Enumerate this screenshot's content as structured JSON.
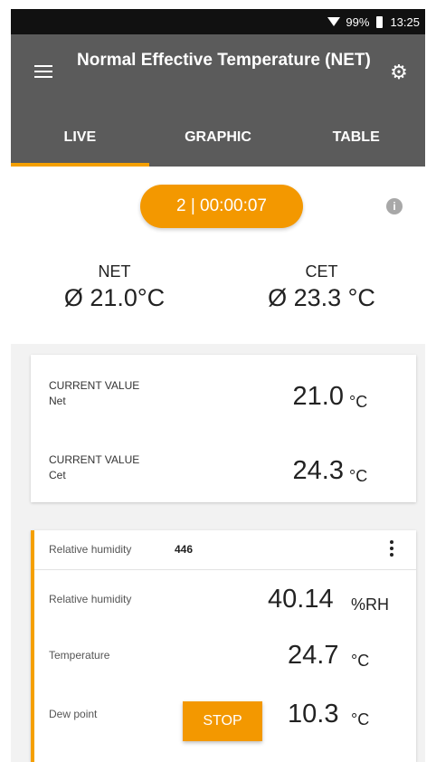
{
  "status_bar": {
    "battery": "99%",
    "time": "13:25"
  },
  "app_bar": {
    "title": "Normal Effective Temperature (NET)"
  },
  "tabs": [
    {
      "label": "LIVE",
      "active": true
    },
    {
      "label": "GRAPHIC",
      "active": false
    },
    {
      "label": "TABLE",
      "active": false
    }
  ],
  "live": {
    "timer": "2 | 00:00:07",
    "summary": [
      {
        "label": "NET",
        "value": "Ø 21.0°C"
      },
      {
        "label": "CET",
        "value": "Ø 23.3 °C"
      }
    ]
  },
  "current_values": [
    {
      "title": "CURRENT VALUE",
      "subtitle": "Net",
      "value": "21.0",
      "unit": "°C"
    },
    {
      "title": "CURRENT VALUE",
      "subtitle": "Cet",
      "value": "24.3",
      "unit": "°C"
    }
  ],
  "probe": {
    "name": "Relative humidity",
    "id": "446",
    "measurements": [
      {
        "label": "Relative humidity",
        "value": "40.14",
        "unit": "%RH"
      },
      {
        "label": "Temperature",
        "value": "24.7",
        "unit": "°C"
      },
      {
        "label": "Dew point",
        "value": "10.3",
        "unit": "°C"
      }
    ]
  },
  "actions": {
    "stop_label": "STOP"
  },
  "colors": {
    "accent": "#f39800",
    "appbar": "#5b5b5b",
    "statusbar": "#111111"
  },
  "icons": [
    "menu-icon",
    "gear-icon",
    "info-icon",
    "kebab-icon",
    "wifi-icon",
    "battery-icon"
  ]
}
